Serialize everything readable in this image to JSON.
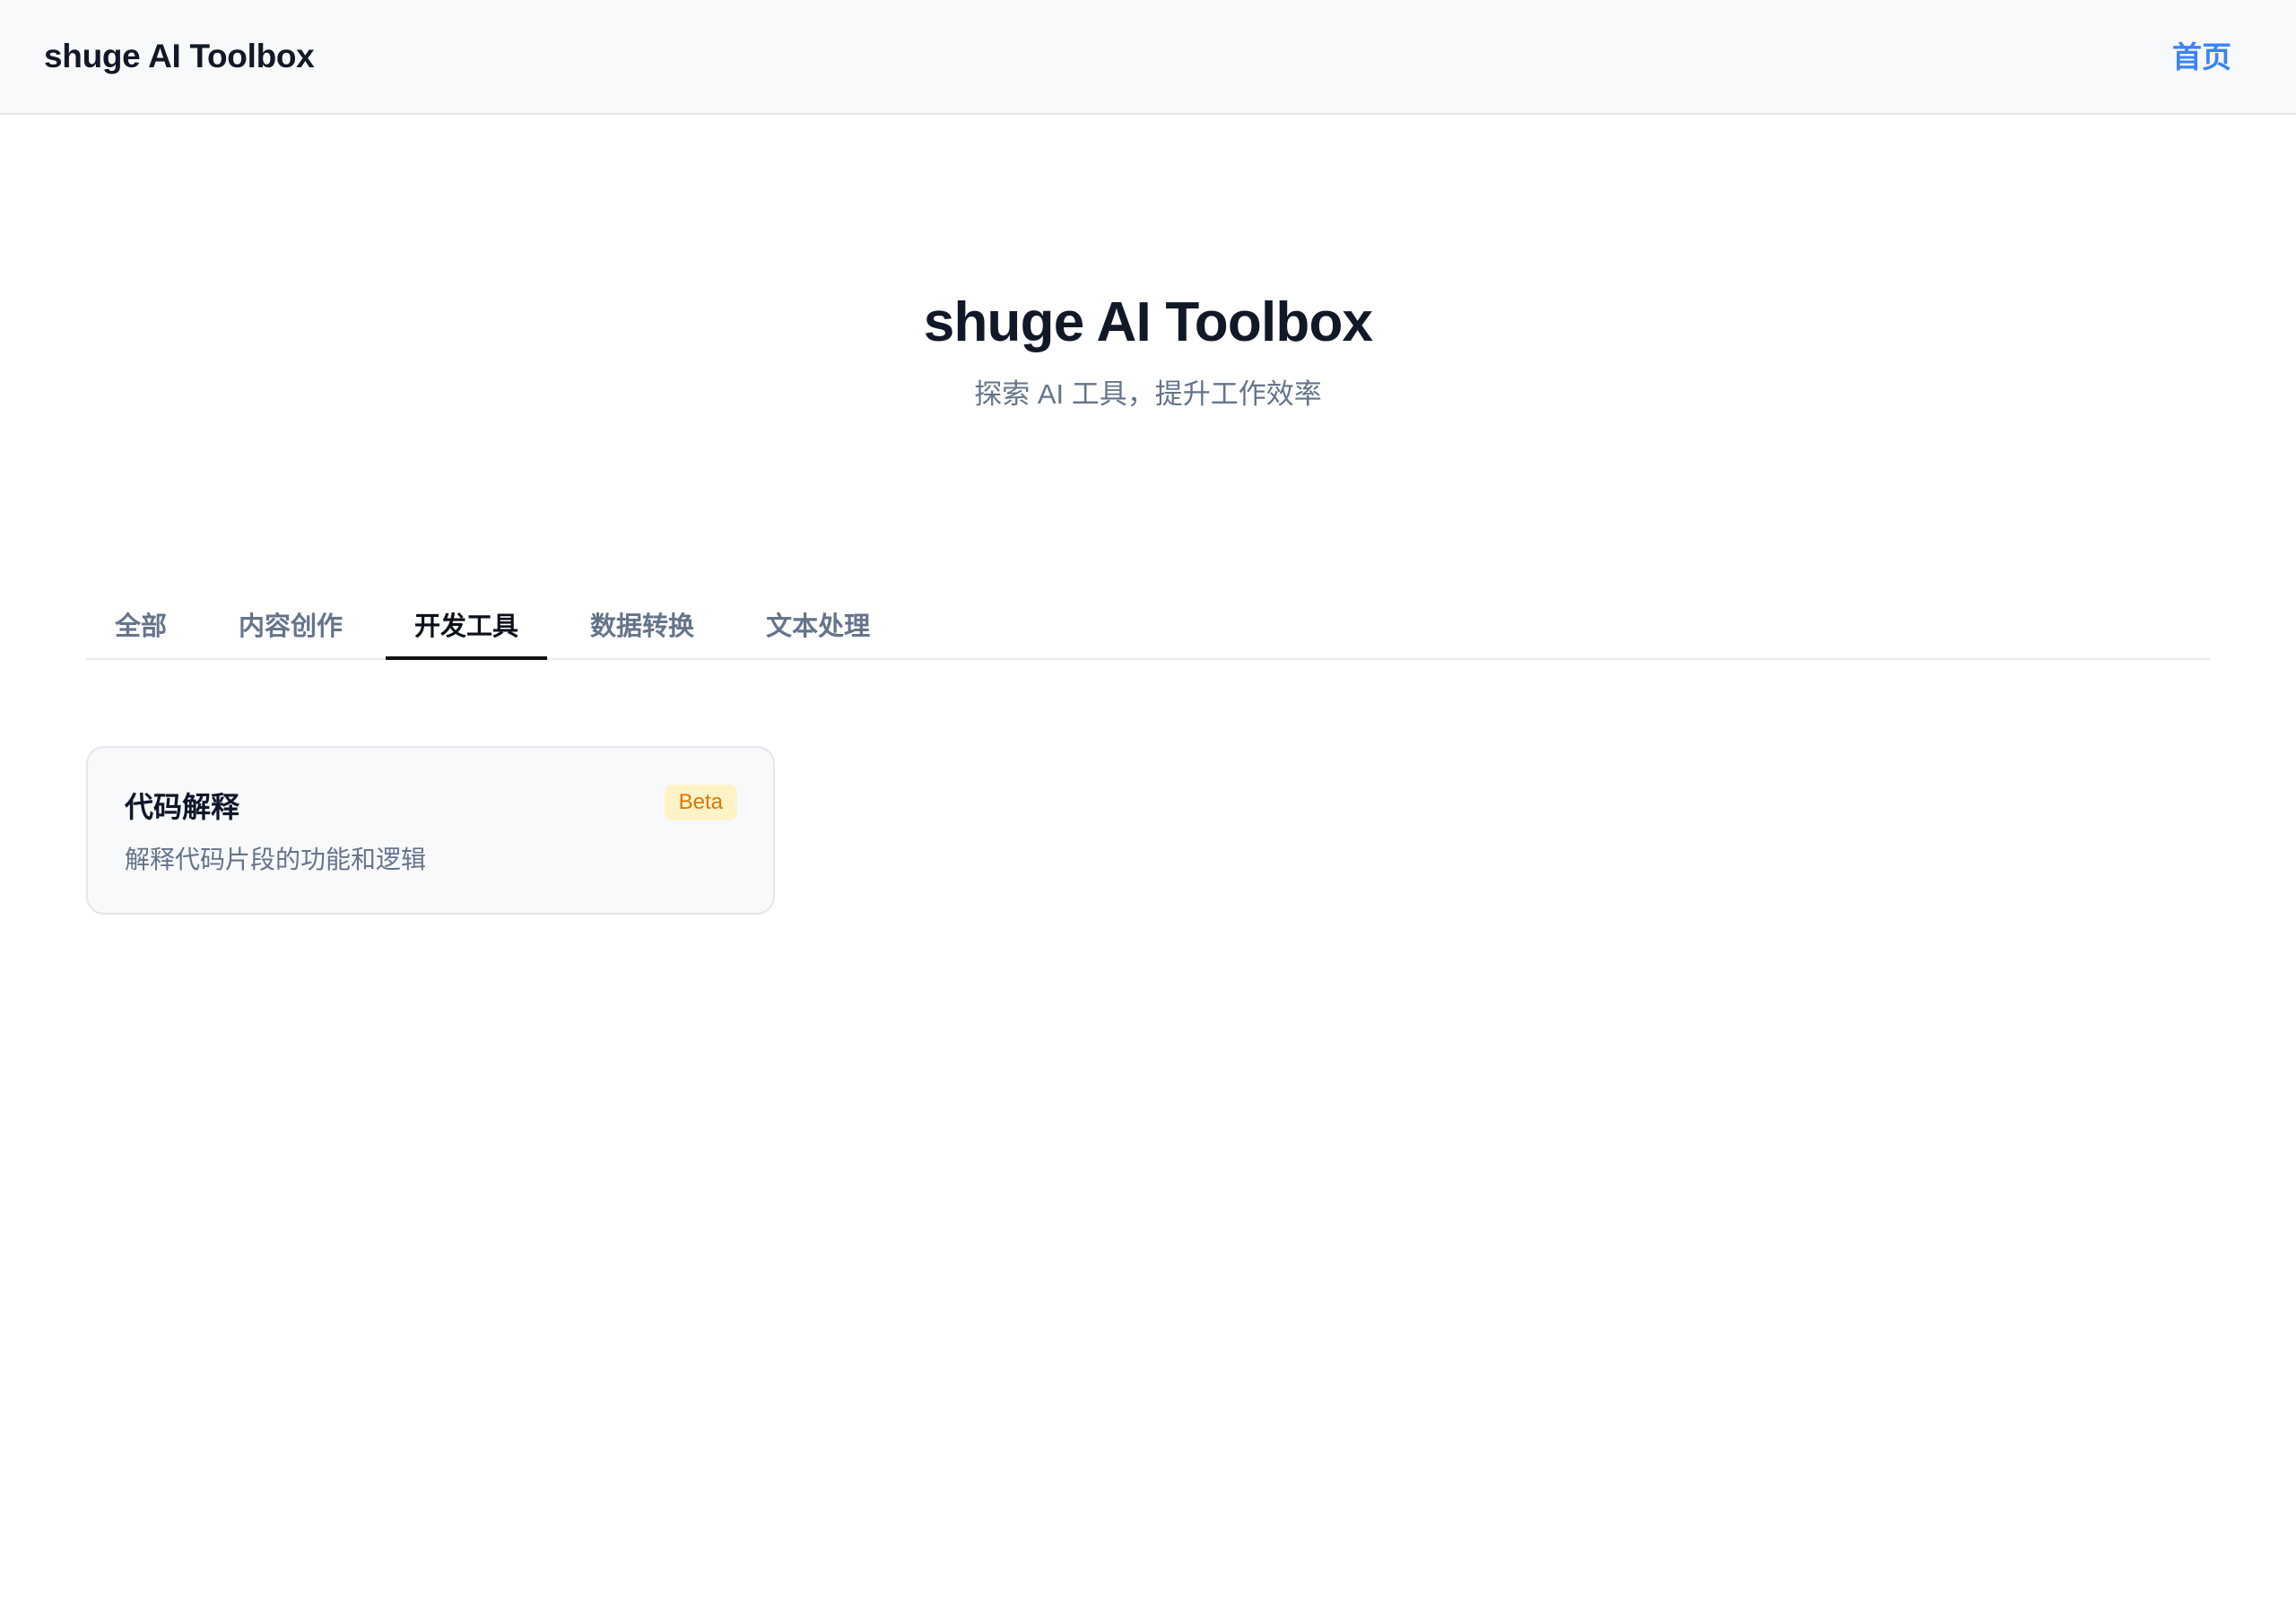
{
  "header": {
    "brand": "shuge AI Toolbox",
    "nav_home": "首页"
  },
  "hero": {
    "title": "shuge AI Toolbox",
    "subtitle": "探索 AI 工具，提升工作效率"
  },
  "tabs": [
    {
      "label": "全部",
      "active": false
    },
    {
      "label": "内容创作",
      "active": false
    },
    {
      "label": "开发工具",
      "active": true
    },
    {
      "label": "数据转换",
      "active": false
    },
    {
      "label": "文本处理",
      "active": false
    }
  ],
  "tools": [
    {
      "title": "代码解释",
      "badge": "Beta",
      "description": "解释代码片段的功能和逻辑"
    }
  ],
  "colors": {
    "accent": "#3b82f6",
    "badge_bg": "#fef3c7",
    "badge_text": "#d97706",
    "active_tab_indicator": "#111111"
  }
}
